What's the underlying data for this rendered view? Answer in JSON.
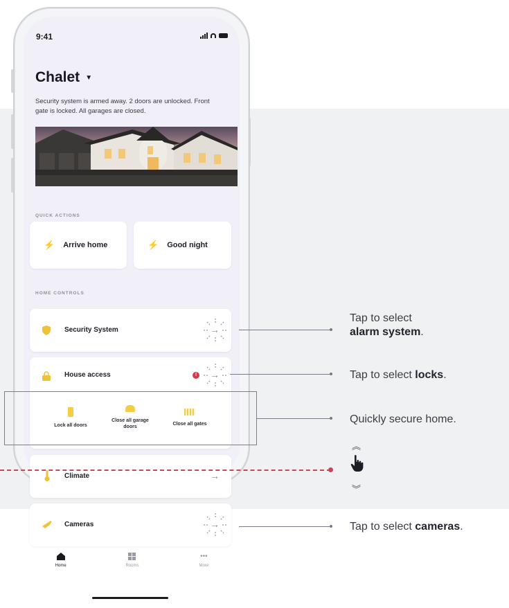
{
  "status": {
    "time": "9:41"
  },
  "home": {
    "title": "Chalet",
    "description": "Security system is armed away. 2 doors are unlocked. Front gate is locked. All garages are closed."
  },
  "quick_actions": {
    "label": "QUICK ACTIONS",
    "items": [
      {
        "label": "Arrive home"
      },
      {
        "label": "Good night"
      }
    ]
  },
  "home_controls": {
    "label": "HOME CONTROLS",
    "security_system": {
      "label": "Security System"
    },
    "house_access": {
      "label": "House access",
      "actions": [
        {
          "label": "Lock all doors"
        },
        {
          "label": "Close all garage doors"
        },
        {
          "label": "Close all gates"
        }
      ]
    },
    "climate": {
      "label": "Climate"
    },
    "cameras": {
      "label": "Cameras"
    }
  },
  "tabbar": {
    "items": [
      {
        "label": "Home",
        "icon": "home-icon",
        "active": true
      },
      {
        "label": "Rooms",
        "icon": "rooms-icon"
      },
      {
        "label": "More",
        "icon": "more-icon"
      }
    ]
  },
  "callouts": {
    "security": {
      "prefix": "Tap to select",
      "bold": "alarm system",
      "suffix": "."
    },
    "access": {
      "prefix": "Tap to select ",
      "bold": "locks",
      "suffix": "."
    },
    "secure": {
      "text": "Quickly secure home."
    },
    "cameras": {
      "prefix": "Tap to select ",
      "bold": "cameras",
      "suffix": "."
    }
  },
  "colors": {
    "accent_yellow": "#f2b52b",
    "alert_red": "#d63a4a",
    "scroll_line_red": "#c94655",
    "background_band": "#f0f1f2"
  }
}
